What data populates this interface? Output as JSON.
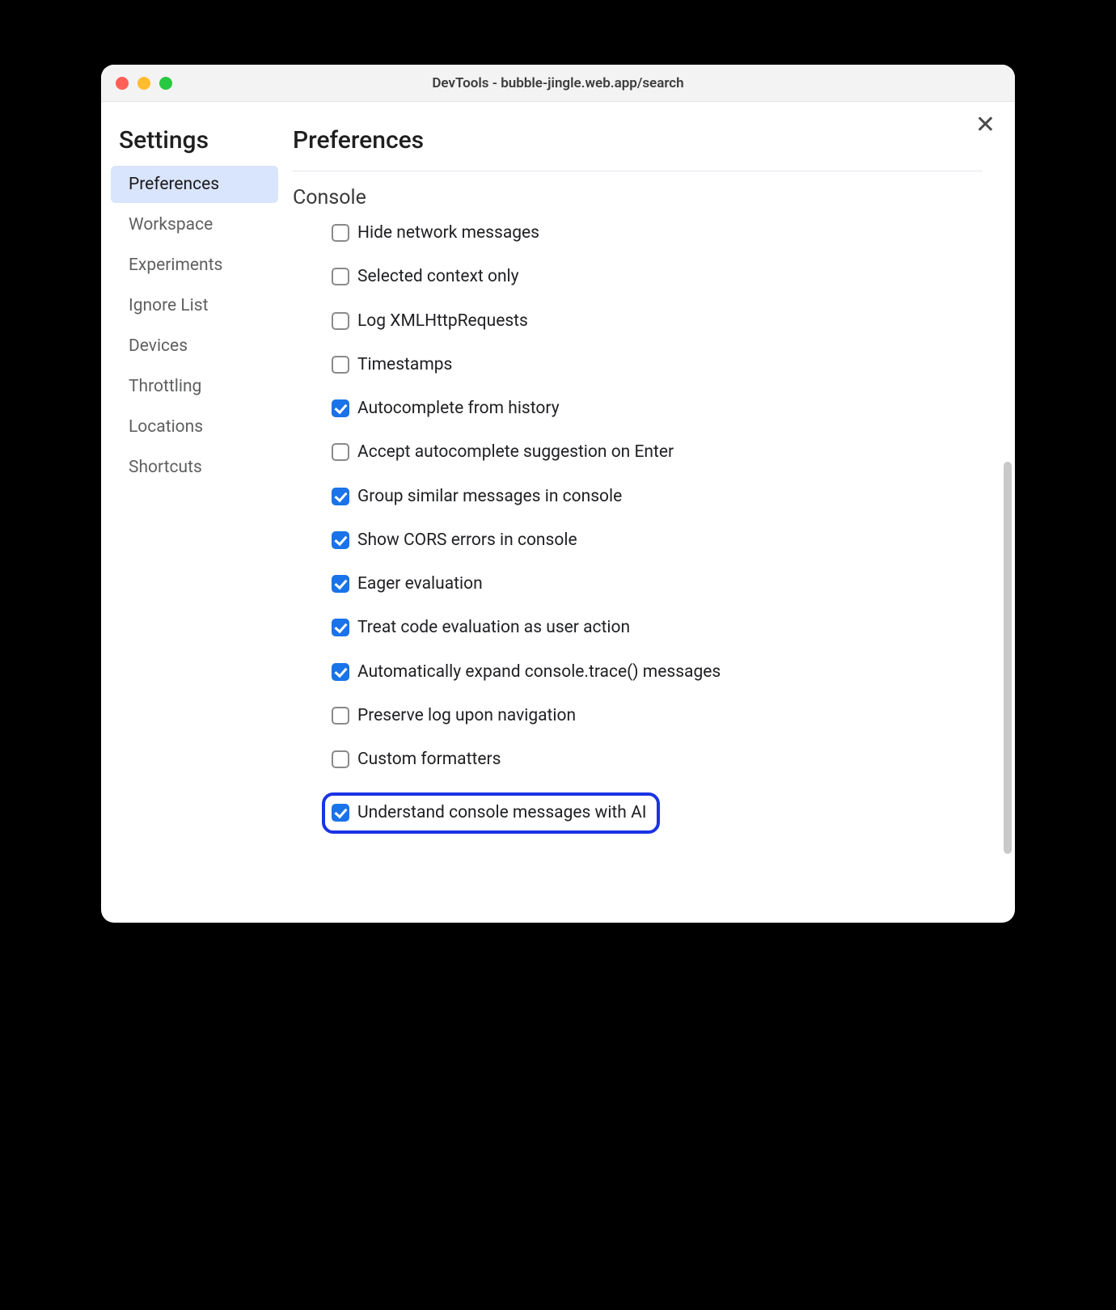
{
  "window": {
    "title": "DevTools - bubble-jingle.web.app/search"
  },
  "sidebar": {
    "title": "Settings",
    "items": [
      {
        "label": "Preferences",
        "active": true
      },
      {
        "label": "Workspace",
        "active": false
      },
      {
        "label": "Experiments",
        "active": false
      },
      {
        "label": "Ignore List",
        "active": false
      },
      {
        "label": "Devices",
        "active": false
      },
      {
        "label": "Throttling",
        "active": false
      },
      {
        "label": "Locations",
        "active": false
      },
      {
        "label": "Shortcuts",
        "active": false
      }
    ]
  },
  "main": {
    "title": "Preferences",
    "section": "Console",
    "options": [
      {
        "label": "Hide network messages",
        "checked": false,
        "highlighted": false
      },
      {
        "label": "Selected context only",
        "checked": false,
        "highlighted": false
      },
      {
        "label": "Log XMLHttpRequests",
        "checked": false,
        "highlighted": false
      },
      {
        "label": "Timestamps",
        "checked": false,
        "highlighted": false
      },
      {
        "label": "Autocomplete from history",
        "checked": true,
        "highlighted": false
      },
      {
        "label": "Accept autocomplete suggestion on Enter",
        "checked": false,
        "highlighted": false
      },
      {
        "label": "Group similar messages in console",
        "checked": true,
        "highlighted": false
      },
      {
        "label": "Show CORS errors in console",
        "checked": true,
        "highlighted": false
      },
      {
        "label": "Eager evaluation",
        "checked": true,
        "highlighted": false
      },
      {
        "label": "Treat code evaluation as user action",
        "checked": true,
        "highlighted": false
      },
      {
        "label": "Automatically expand console.trace() messages",
        "checked": true,
        "highlighted": false
      },
      {
        "label": "Preserve log upon navigation",
        "checked": false,
        "highlighted": false
      },
      {
        "label": "Custom formatters",
        "checked": false,
        "highlighted": false
      },
      {
        "label": "Understand console messages with AI",
        "checked": true,
        "highlighted": true
      }
    ]
  }
}
